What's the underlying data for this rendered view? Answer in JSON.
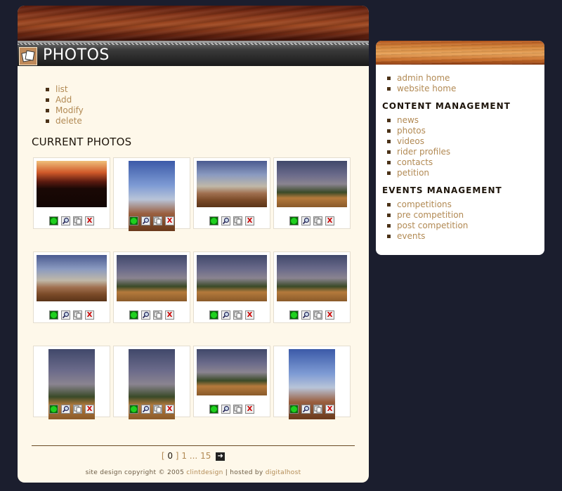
{
  "header": {
    "title": "PHOTOS"
  },
  "sub_menu": [
    "list",
    "Add",
    "Modify",
    "delete"
  ],
  "section_title": "CURRENT PHOTOS",
  "photos": [
    {
      "style": "sunset",
      "w": 100,
      "h": 66
    },
    {
      "style": "tall",
      "w": 66,
      "h": 100
    },
    {
      "style": "sky",
      "w": 100,
      "h": 66
    },
    {
      "style": "dusk",
      "w": 100,
      "h": 66
    },
    {
      "style": "sky",
      "w": 100,
      "h": 66
    },
    {
      "style": "dusk",
      "w": 100,
      "h": 66
    },
    {
      "style": "dusk",
      "w": 100,
      "h": 66
    },
    {
      "style": "dusk",
      "w": 100,
      "h": 66
    },
    {
      "style": "dusk",
      "w": 66,
      "h": 100
    },
    {
      "style": "dusk",
      "w": 66,
      "h": 100
    },
    {
      "style": "dusk",
      "w": 100,
      "h": 66
    },
    {
      "style": "tall",
      "w": 66,
      "h": 100
    }
  ],
  "action_icons": [
    "view-icon",
    "zoom-icon",
    "copy-icon",
    "delete-icon"
  ],
  "delete_glyph": "X",
  "pagination": {
    "open": "[",
    "current": "0",
    "close": "]",
    "first": "1",
    "ellipsis": "...",
    "last": "15",
    "next_icon": "next-arrow-icon"
  },
  "footer": {
    "text_prefix": "site design copyright © 2005 ",
    "designer": "clintdesign",
    "separator": " | hosted by ",
    "host": "digitalhost"
  },
  "side_nav": {
    "top_links": [
      "admin home",
      "website home"
    ],
    "content_heading": "CONTENT MANAGEMENT",
    "content_links": [
      "news",
      "photos",
      "videos",
      "rider profiles",
      "contacts",
      "petition"
    ],
    "events_heading": "EVENTS MANAGEMENT",
    "events_links": [
      "competitions",
      "pre competition",
      "post competition",
      "events"
    ]
  },
  "colors": {
    "page_bg": "#1b1e2e",
    "panel_bg": "#fef8ea",
    "link": "#b28a54",
    "heading": "#1d140a"
  }
}
